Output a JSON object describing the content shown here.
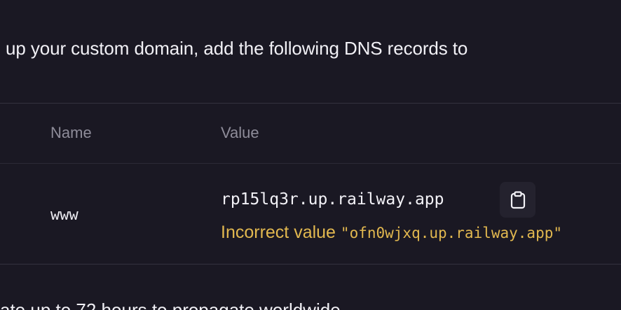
{
  "intro": {
    "text": "up your custom domain, add the following DNS records to"
  },
  "table": {
    "columns": [
      "Name",
      "Value"
    ],
    "rows": [
      {
        "name": "www",
        "value": "rp15lq3r.up.railway.app",
        "error_label": "Incorrect value ",
        "error_value": "\"ofn0wjxq.up.railway.app\""
      }
    ]
  },
  "footer": {
    "partial_text": "ate up to 72 hours to propagate worldwide"
  },
  "colors": {
    "background": "#1a1823",
    "warning": "#e2b84f",
    "muted": "#8e8c99"
  },
  "icons": {
    "copy": "clipboard-icon"
  }
}
